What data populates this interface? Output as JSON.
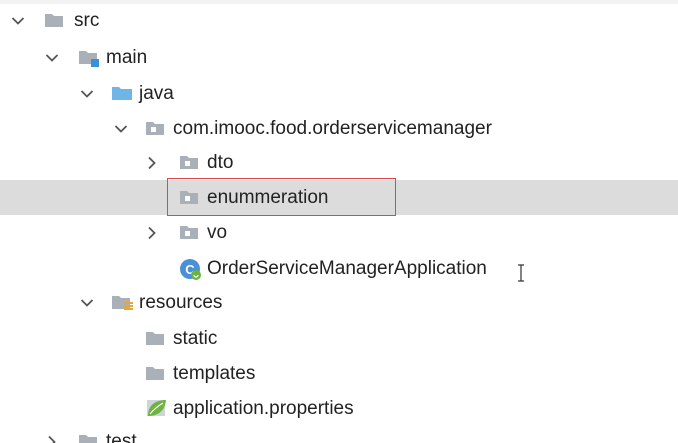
{
  "colors": {
    "folder_gray": "#a9b0b8",
    "folder_blue": "#6fb5e6",
    "selection_bg": "#dcdcdc",
    "highlight_border": "#d94a4a",
    "spring_green": "#6db33f",
    "text": "#222222"
  },
  "tree": {
    "src": {
      "label": "src",
      "icon": "folder-icon",
      "expanded": true
    },
    "main": {
      "label": "main",
      "icon": "source-folder-icon",
      "expanded": true
    },
    "java": {
      "label": "java",
      "icon": "java-source-root-icon",
      "expanded": true
    },
    "package": {
      "label": "com.imooc.food.orderservicemanager",
      "icon": "package-icon",
      "expanded": true
    },
    "dto": {
      "label": "dto",
      "icon": "package-icon",
      "expanded": false
    },
    "enummeration": {
      "label": "enummeration",
      "icon": "package-icon",
      "selected": true
    },
    "vo": {
      "label": "vo",
      "icon": "package-icon",
      "expanded": false
    },
    "application_class": {
      "label": "OrderServiceManagerApplication",
      "icon": "spring-boot-class-icon"
    },
    "resources": {
      "label": "resources",
      "icon": "resources-folder-icon",
      "expanded": true
    },
    "static": {
      "label": "static",
      "icon": "folder-icon"
    },
    "templates": {
      "label": "templates",
      "icon": "folder-icon"
    },
    "application_properties": {
      "label": "application.properties",
      "icon": "spring-properties-icon"
    },
    "test": {
      "label": "test",
      "icon": "folder-icon",
      "expanded": false
    }
  }
}
